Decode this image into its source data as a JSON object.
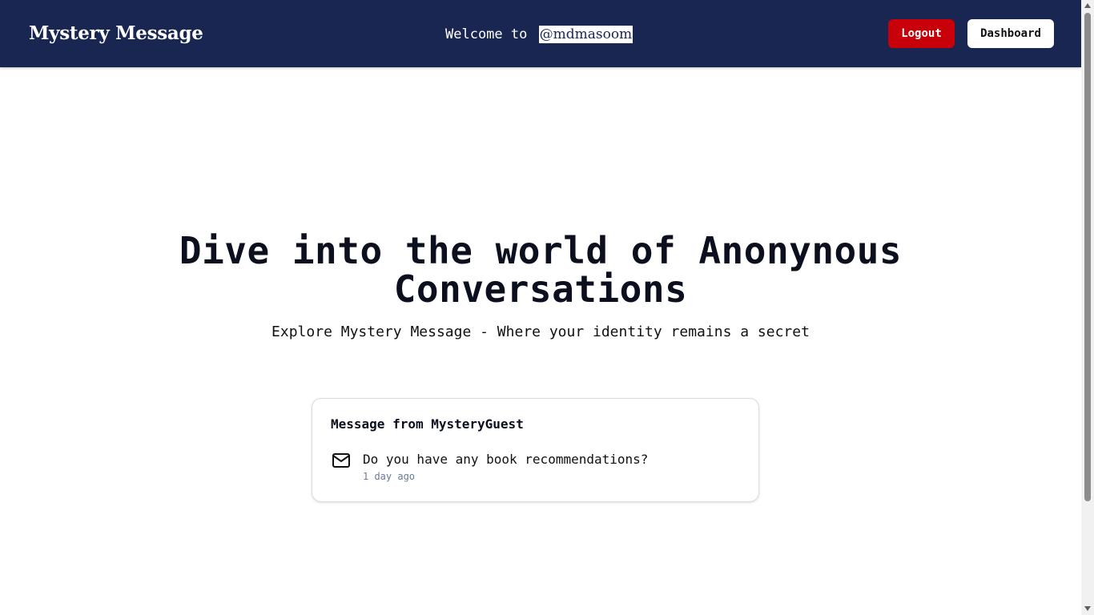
{
  "navbar": {
    "brand": "Mystery Message",
    "welcome_prefix": "Welcome to",
    "username": "@mdmasoom",
    "logout_label": "Logout",
    "dashboard_label": "Dashboard",
    "background_color": "#192651",
    "logout_color": "#c8000a"
  },
  "hero": {
    "title": "Dive into the world of Anonynous Conversations",
    "subtitle": "Explore Mystery Message - Where your identity remains a secret"
  },
  "message_card": {
    "title": "Message from MysteryGuest",
    "icon": "mail-icon",
    "content": "Do you have any book recommendations?",
    "time": "1 day ago"
  }
}
